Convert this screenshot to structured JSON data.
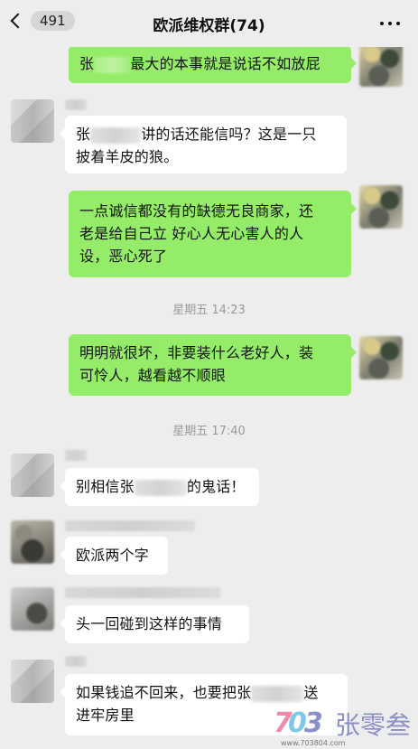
{
  "nav": {
    "back_count": "491",
    "title": "欧派维权群(74)"
  },
  "messages": [
    {
      "side": "right",
      "parts": [
        "张",
        "",
        "最大的本事就是说话不如放屁"
      ]
    },
    {
      "side": "left",
      "parts": [
        "张",
        "",
        "讲的话还能信吗？这是一只",
        "披着羊皮的狼。"
      ]
    },
    {
      "side": "right",
      "lines": [
        "一点诚信都没有的缺德无良商家，还",
        "老是给自己立 好心人无心害人的人",
        "设，恶心死了"
      ]
    },
    {
      "side": "right",
      "lines": [
        "明明就很坏，非要装什么老好人，装",
        "可怜人，越看越不顺眼"
      ]
    },
    {
      "side": "left",
      "parts": [
        "别相信张",
        "",
        "的鬼话！"
      ]
    },
    {
      "side": "left",
      "lines": [
        "欧派两个字"
      ]
    },
    {
      "side": "left",
      "lines": [
        "头一回碰到这样的事情"
      ]
    },
    {
      "side": "left",
      "parts": [
        "如果钱追不回来，也要把张",
        "",
        "送",
        "进牢房里"
      ]
    }
  ],
  "timestamps": [
    "星期五 14:23",
    "星期五 17:40"
  ],
  "watermark": {
    "brand": "张零叁",
    "url": "www.703804.com",
    "logo_text": "703"
  },
  "colors": {
    "bubble_green": "#95ec69",
    "bubble_white": "#ffffff",
    "background": "#ededed"
  }
}
